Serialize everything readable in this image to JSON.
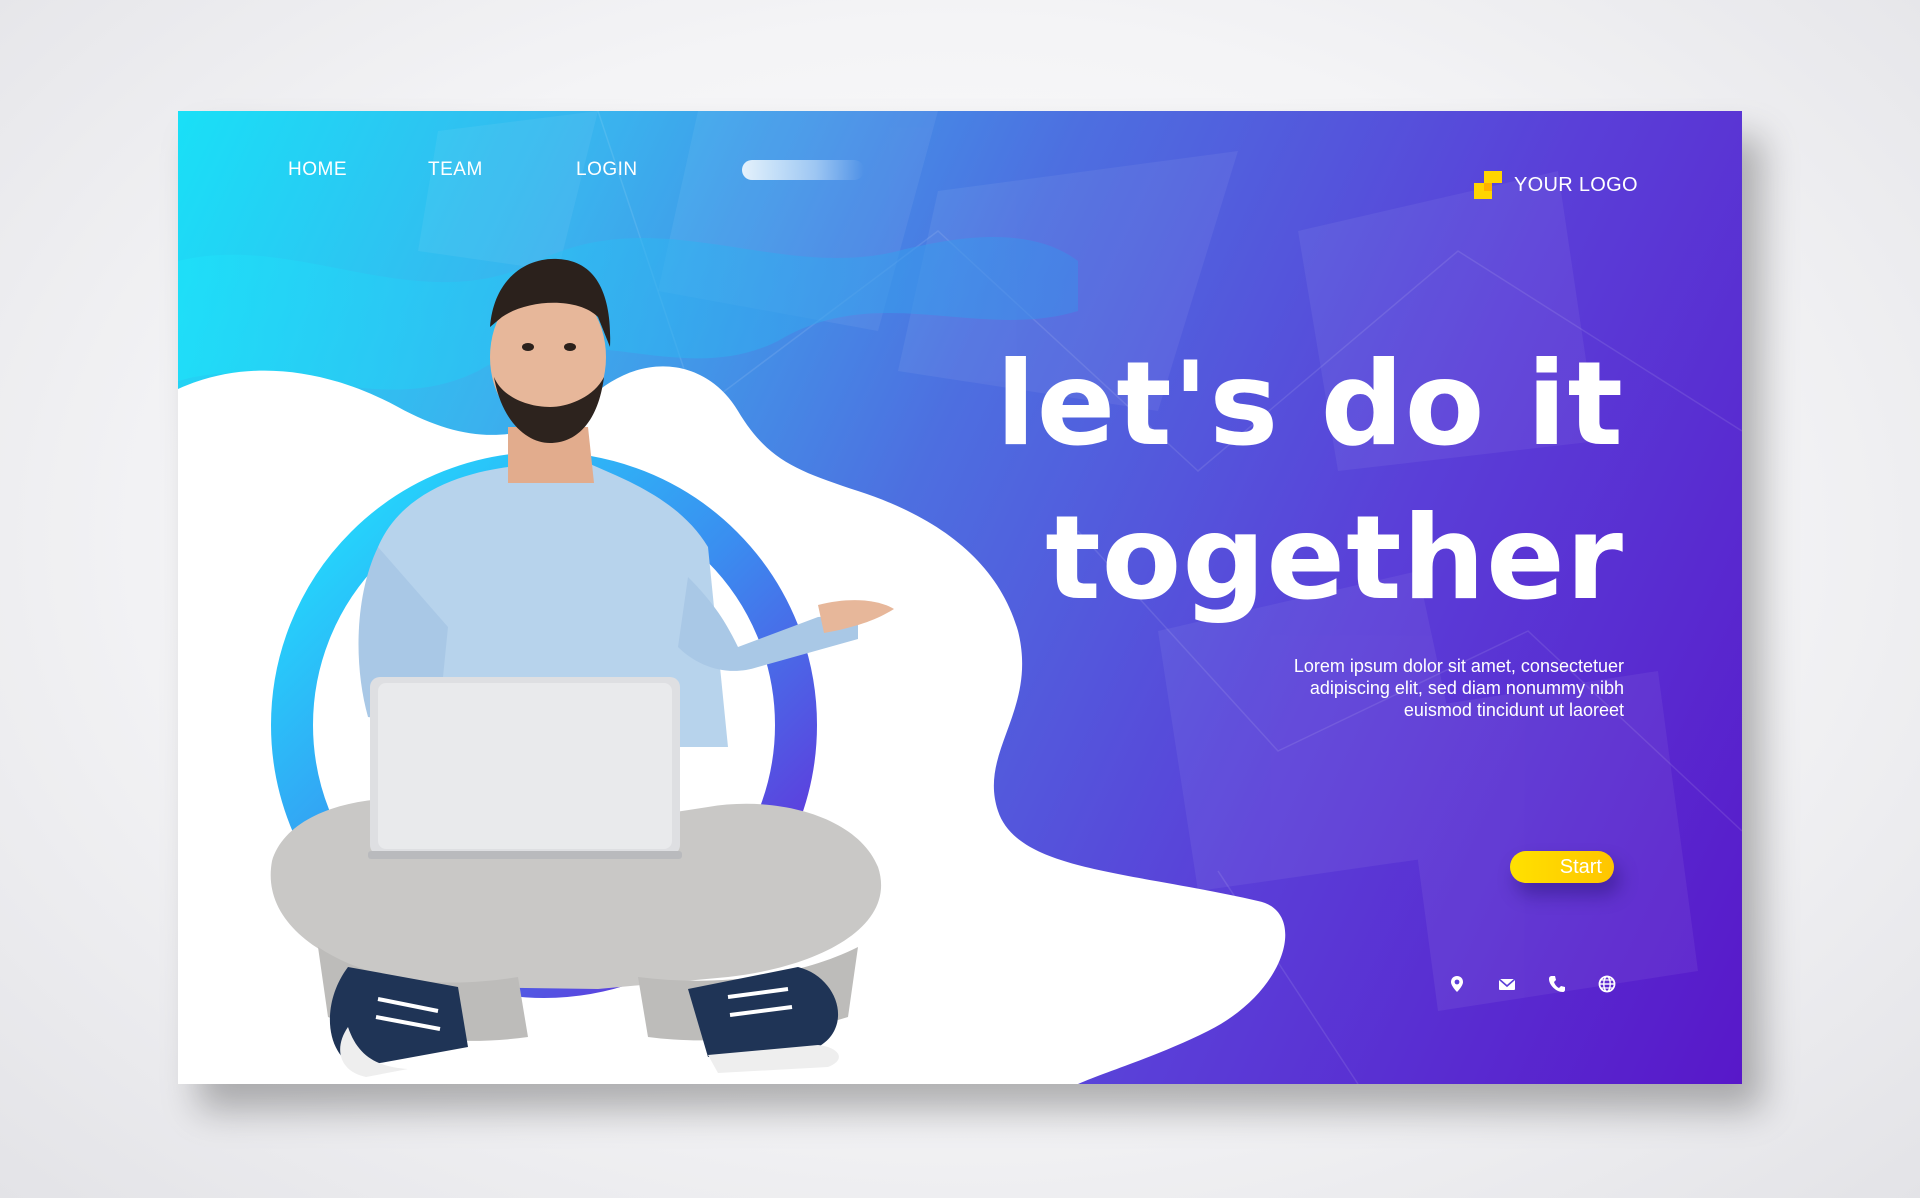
{
  "nav": {
    "items": [
      {
        "label": "HOME"
      },
      {
        "label": "TEAM"
      },
      {
        "label": "LOGIN"
      }
    ]
  },
  "logo": {
    "text": "YOUR LOGO",
    "icon": "pixel-square-logo-icon",
    "color": "#ffd400"
  },
  "hero": {
    "line1": "let's do it",
    "line2": "together",
    "body_lines": [
      "Lorem ipsum dolor sit amet, consectetuer",
      "adipiscing elit, sed diam nonummy nibh",
      "euismod tincidunt ut laoreet"
    ]
  },
  "cta": {
    "label": "Start",
    "color": "#ffd400"
  },
  "contact_icons": [
    "location-pin-icon",
    "mail-icon",
    "phone-icon",
    "globe-icon"
  ],
  "colors": {
    "gradient_start": "#19e0f7",
    "gradient_end": "#5818c9",
    "text": "#ffffff"
  }
}
